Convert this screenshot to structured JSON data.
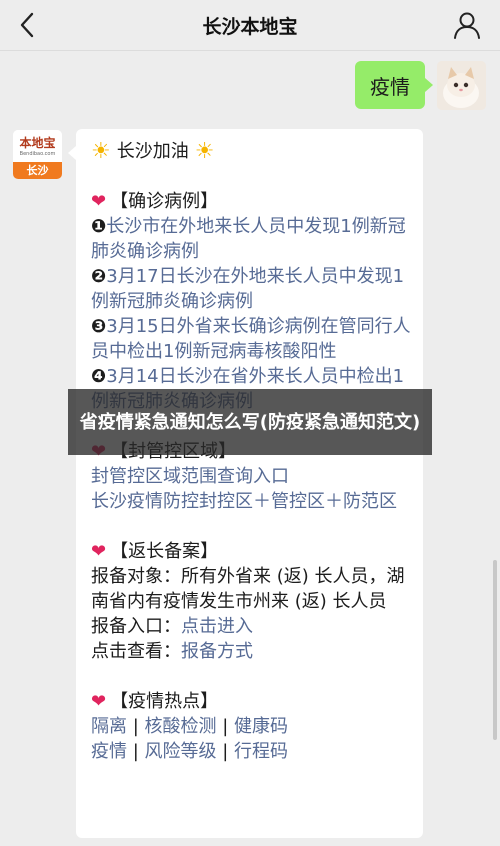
{
  "nav": {
    "title": "长沙本地宝",
    "back_icon": "chevron-left-icon",
    "user_icon": "user-icon"
  },
  "outgoing": {
    "text": "疫情"
  },
  "bot_avatar": {
    "brand": "本地宝",
    "sub": "Bendibao.com",
    "city": "长沙"
  },
  "message": {
    "header": "长沙加油",
    "sections": [
      {
        "title": "【确诊病例】",
        "items": [
          {
            "num": "❶",
            "text": "长沙市在外地来长人员中发现1例新冠肺炎确诊病例"
          },
          {
            "num": "❷",
            "text": "3月17日长沙在外地来长人员中发现1例新冠肺炎确诊病例"
          },
          {
            "num": "❸",
            "text": "3月15日外省来长确诊病例在管同行人员中检出1例新冠病毒核酸阳性"
          },
          {
            "num": "❹",
            "text": "3月14日长沙在省外来长人员中检出1例新冠肺炎确诊病例"
          }
        ]
      },
      {
        "title": "【封管控区域】",
        "lines": [
          "封管控区域范围查询入口",
          "长沙疫情防控封控区＋管控区＋防范区"
        ]
      },
      {
        "title": "【返长备案】",
        "body": "报备对象：所有外省来 (返) 长人员，湖南省内有疫情发生市州来 (返) 长人员",
        "entry_label": "报备入口：",
        "entry_link": "点击进入",
        "view_label": "点击查看：",
        "view_link": "报备方式"
      },
      {
        "title": "【疫情热点】",
        "row1": [
          "隔离",
          "核酸检测",
          "健康码"
        ],
        "row2": [
          "疫情",
          "风险等级",
          "行程码"
        ],
        "separator": " | "
      }
    ]
  },
  "overlay": {
    "text": "省疫情紧急通知怎么写(防疫紧急通知范文)"
  },
  "colors": {
    "link": "#576b95",
    "bubble_out": "#95ec69",
    "heart": "#e0245e",
    "avatar_orange": "#f07a1f"
  }
}
